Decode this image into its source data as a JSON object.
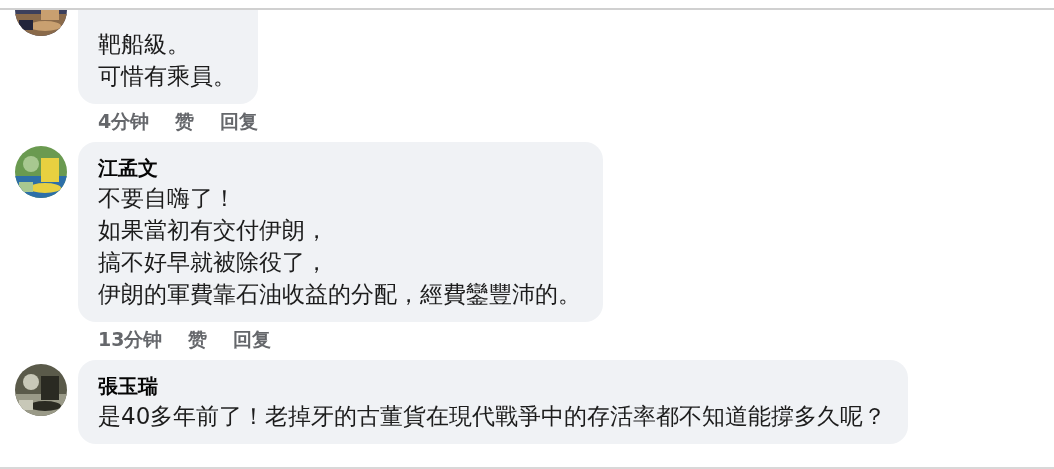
{
  "comments": [
    {
      "lines": [
        "靶船級。",
        "可惜有乘員。"
      ],
      "time": "4分钟",
      "like": "赞",
      "reply": "回复"
    },
    {
      "author": "江孟文",
      "lines": [
        "不要自嗨了！",
        "如果當初有交付伊朗，",
        "搞不好早就被除役了，",
        "伊朗的軍費靠石油收益的分配，經費鑾豐沛的。"
      ],
      "time": "13分钟",
      "like": "赞",
      "reply": "回复"
    },
    {
      "author": "張玉瑞",
      "lines": [
        "是40多年前了！老掉牙的古董貨在現代戰爭中的存活率都不知道能撐多久呢？"
      ]
    }
  ]
}
